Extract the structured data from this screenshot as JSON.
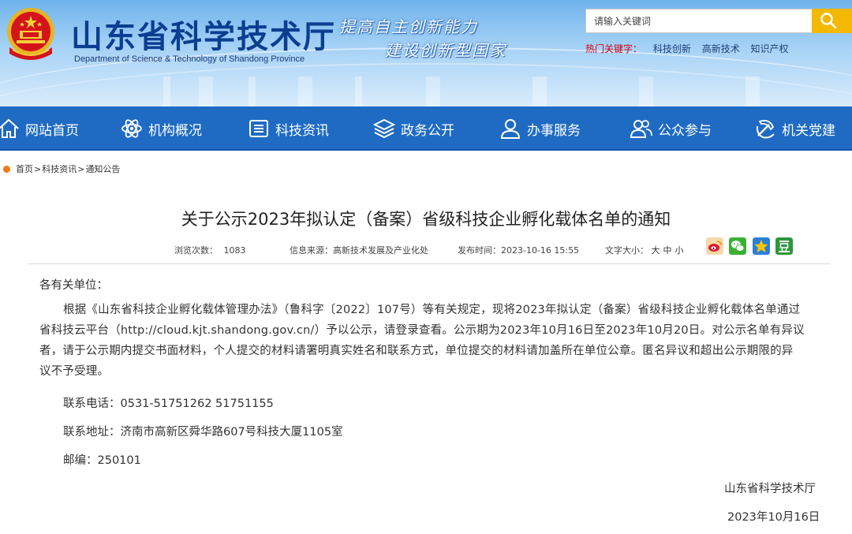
{
  "header": {
    "site_title": "山东省科学技术厅",
    "site_subtitle": "Department of Science & Technology of Shandong Province",
    "slogan_line1": "提高自主创新能力",
    "slogan_line2": "建设创新型国家",
    "search_placeholder": "请输入关键词",
    "hotwords_label": "热门关键字：",
    "hotwords": [
      "科技创新",
      "高新技术",
      "知识产权"
    ]
  },
  "nav": {
    "items": [
      {
        "label": "网站首页",
        "icon": "home-icon"
      },
      {
        "label": "机构概况",
        "icon": "atom-icon"
      },
      {
        "label": "科技资讯",
        "icon": "news-icon"
      },
      {
        "label": "政务公开",
        "icon": "layers-icon"
      },
      {
        "label": "办事服务",
        "icon": "person-icon"
      },
      {
        "label": "公众参与",
        "icon": "people-icon"
      },
      {
        "label": "机关党建",
        "icon": "party-icon"
      }
    ]
  },
  "breadcrumb": [
    "首页",
    "科技资讯",
    "通知公告"
  ],
  "article": {
    "title": "关于公示2023年拟认定（备案）省级科技企业孵化载体名单的通知",
    "views_label": "浏览次数：",
    "views": "1083",
    "source_label": "信息来源：",
    "source": "高新技术发展及产业化处",
    "date_label": "发布时间：",
    "date": "2023-10-16 15:55",
    "fontsize_label": "文字大小：",
    "fontsize_options": [
      "大",
      "中",
      "小"
    ],
    "greeting": "各有关单位：",
    "body_lines": [
      "根据《山东省科技企业孵化载体管理办法》（鲁科字〔2022〕107号）等有关规定，现将2023年拟认定（备案）省级科技企业孵化载体名单通过",
      "省科技云平台（http://cloud.kjt.shandong.gov.cn/）予以公示，请登录查看。公示期为2023年10月16日至2023年10月20日。对公示名单有异议",
      "者，请于公示期内提交书面材料，个人提交的材料请署明真实姓名和联系方式，单位提交的材料请加盖所在单位公章。匿名异议和超出公示期限的异",
      "议不予受理。"
    ],
    "phone": "联系电话：0531-51751262  51751155",
    "address": "联系地址：济南市高新区舜华路607号科技大厦1105室",
    "postcode": "邮编：250101",
    "signature": "山东省科学技术厅",
    "sign_date": "2023年10月16日"
  },
  "share": [
    "weibo-icon",
    "wechat-icon",
    "qzone-icon",
    "douban-icon"
  ],
  "colors": {
    "nav_bg": "#1f6bc4",
    "title_blue": "#0b3d91",
    "search_button": "#f5b800",
    "hot_label": "#d7000f",
    "breadcrumb_dot": "#ef7a17"
  }
}
